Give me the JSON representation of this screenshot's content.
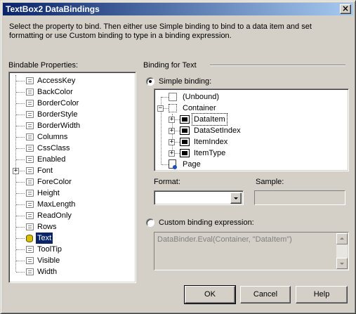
{
  "window": {
    "title": "TextBox2 DataBindings",
    "close_glyph": "×"
  },
  "instructions": "Select the property to bind. Then either use Simple binding to bind to a data item and set formatting or use Custom binding to type in a binding expression.",
  "bindable": {
    "label": "Bindable Properties:",
    "items": [
      {
        "label": "AccessKey",
        "icon": "property-icon"
      },
      {
        "label": "BackColor",
        "icon": "property-icon"
      },
      {
        "label": "BorderColor",
        "icon": "property-icon"
      },
      {
        "label": "BorderStyle",
        "icon": "property-icon"
      },
      {
        "label": "BorderWidth",
        "icon": "property-icon"
      },
      {
        "label": "Columns",
        "icon": "property-icon"
      },
      {
        "label": "CssClass",
        "icon": "property-icon"
      },
      {
        "label": "Enabled",
        "icon": "property-icon"
      },
      {
        "label": "Font",
        "icon": "property-icon",
        "expandable": true
      },
      {
        "label": "ForeColor",
        "icon": "property-icon"
      },
      {
        "label": "Height",
        "icon": "property-icon"
      },
      {
        "label": "MaxLength",
        "icon": "property-icon"
      },
      {
        "label": "ReadOnly",
        "icon": "property-icon"
      },
      {
        "label": "Rows",
        "icon": "property-icon"
      },
      {
        "label": "Text",
        "icon": "database-icon",
        "selected": true
      },
      {
        "label": "ToolTip",
        "icon": "property-icon"
      },
      {
        "label": "Visible",
        "icon": "property-icon"
      },
      {
        "label": "Width",
        "icon": "property-icon"
      }
    ]
  },
  "binding": {
    "group_label": "Binding for Text",
    "simple_label": "Simple binding:",
    "simple_selected": true,
    "tree": [
      {
        "label": "(Unbound)",
        "icon": "unbound-icon"
      },
      {
        "label": "Container",
        "icon": "container-icon",
        "expanded": true
      },
      {
        "label": "DataItem",
        "icon": "data-item-icon",
        "current": true
      },
      {
        "label": "DataSetIndex",
        "icon": "data-item-icon"
      },
      {
        "label": "ItemIndex",
        "icon": "data-item-icon"
      },
      {
        "label": "ItemType",
        "icon": "data-item-icon"
      },
      {
        "label": "Page",
        "icon": "page-icon"
      }
    ],
    "format_label": "Format:",
    "format_value": "",
    "sample_label": "Sample:",
    "sample_value": "",
    "custom_label": "Custom binding expression:",
    "custom_selected": false,
    "custom_expression": "DataBinder.Eval(Container, \"DataItem\")"
  },
  "buttons": {
    "ok": "OK",
    "cancel": "Cancel",
    "help": "Help"
  },
  "colors": {
    "face": "#d4d0c8",
    "title_start": "#0a246a",
    "title_end": "#a6caf0",
    "selection": "#0a246a"
  }
}
